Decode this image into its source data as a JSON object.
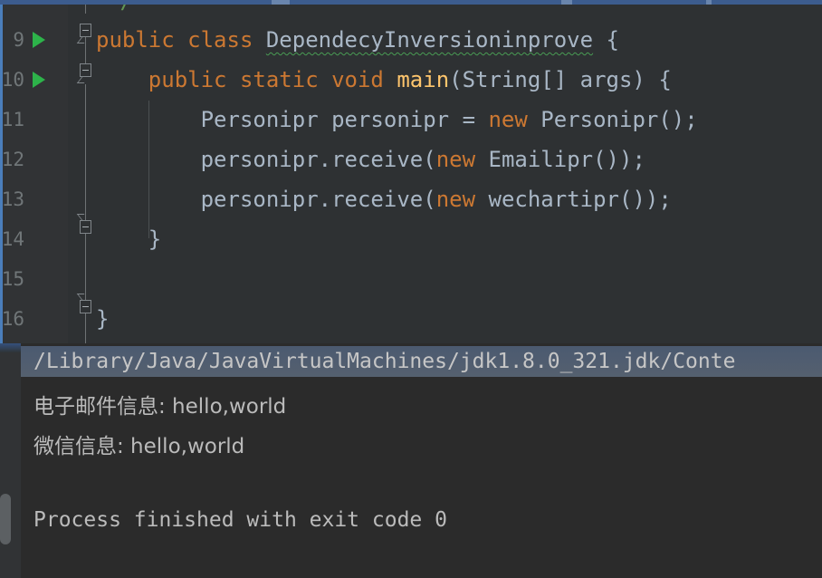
{
  "theme": {
    "editor_bg": "#2e3133",
    "gutter_bg": "#313335",
    "console_bg": "#2b2b2b",
    "accent_blue": "#3c5c8e",
    "keyword_orange": "#cc7832",
    "method_gold": "#ffc66d",
    "text_gray": "#a9b7c6",
    "comment_green": "#629755",
    "run_arrow_green": "#2db34a",
    "warning_squiggle": "#499c54"
  },
  "editor": {
    "cut_off_top_comment": "*/",
    "lines": [
      {
        "number": "9",
        "has_run_arrow": true,
        "tokens": [
          {
            "text": "public class ",
            "style": "kw"
          },
          {
            "text": "DependecyInversioninprove",
            "style": "typo"
          },
          {
            "text": " {",
            "style": "plain"
          }
        ]
      },
      {
        "number": "10",
        "has_run_arrow": true,
        "tokens": [
          {
            "text": "    public static void ",
            "style": "kw"
          },
          {
            "text": "main",
            "style": "fn"
          },
          {
            "text": "(String[] args) {",
            "style": "plain"
          }
        ]
      },
      {
        "number": "11",
        "has_run_arrow": false,
        "tokens": [
          {
            "text": "        Personipr personipr = ",
            "style": "plain"
          },
          {
            "text": "new",
            "style": "kw"
          },
          {
            "text": " Personipr();",
            "style": "plain"
          }
        ]
      },
      {
        "number": "12",
        "has_run_arrow": false,
        "tokens": [
          {
            "text": "        personipr.receive(",
            "style": "plain"
          },
          {
            "text": "new",
            "style": "kw"
          },
          {
            "text": " Emailipr());",
            "style": "plain"
          }
        ]
      },
      {
        "number": "13",
        "has_run_arrow": false,
        "tokens": [
          {
            "text": "        personipr.receive(",
            "style": "plain"
          },
          {
            "text": "new",
            "style": "kw"
          },
          {
            "text": " wechartipr());",
            "style": "plain"
          }
        ]
      },
      {
        "number": "14",
        "has_run_arrow": false,
        "tokens": [
          {
            "text": "    }",
            "style": "plain"
          }
        ]
      },
      {
        "number": "15",
        "has_run_arrow": false,
        "tokens": []
      },
      {
        "number": "16",
        "has_run_arrow": false,
        "tokens": [
          {
            "text": "}",
            "style": "plain"
          }
        ]
      }
    ]
  },
  "console": {
    "command_line": "/Library/Java/JavaVirtualMachines/jdk1.8.0_321.jdk/Conte",
    "output_lines": [
      "电子邮件信息: hello,world",
      "微信信息: hello,world",
      "",
      "Process finished with exit code 0"
    ],
    "exit_code": "0"
  }
}
